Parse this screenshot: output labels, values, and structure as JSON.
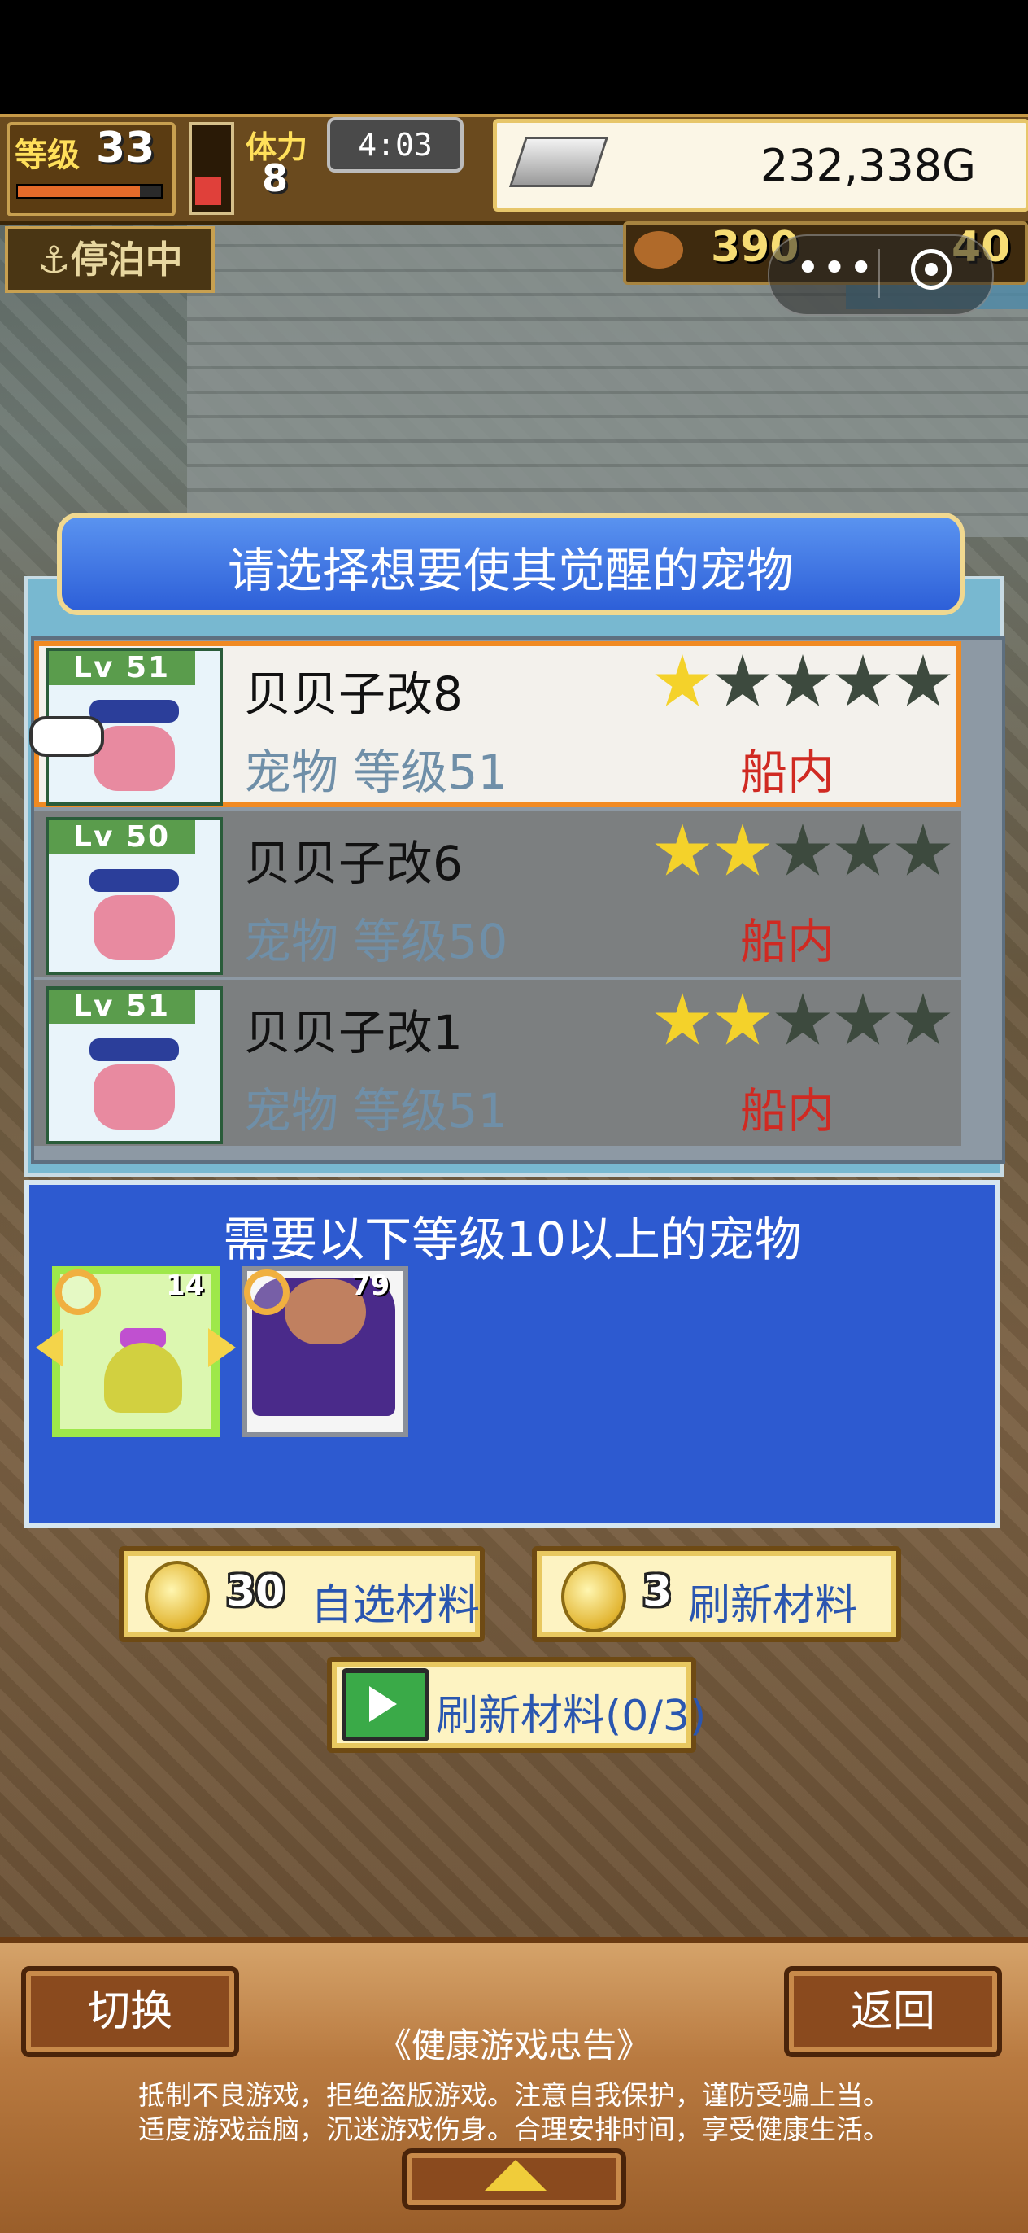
{
  "hud": {
    "level_label": "等级",
    "level_value": "33",
    "stamina_label": "体力",
    "stamina_value": "8",
    "clock": "4:03",
    "gold": "232,338G",
    "status": "⚓停泊中",
    "food_value": "390",
    "food_value2": "40"
  },
  "mini_program": {
    "more_icon": "more-dots-icon",
    "close_icon": "target-close-icon"
  },
  "dialog": {
    "title": "请选择想要使其觉醒的宠物",
    "pets": [
      {
        "level_badge": "Lv 51",
        "name": "贝贝子改8",
        "sub": "宠物 等级51",
        "location": "船内",
        "stars": 1,
        "max_stars": 5,
        "selected": true
      },
      {
        "level_badge": "Lv 50",
        "name": "贝贝子改6",
        "sub": "宠物 等级50",
        "location": "船内",
        "stars": 2,
        "max_stars": 5,
        "selected": false
      },
      {
        "level_badge": "Lv 51",
        "name": "贝贝子改1",
        "sub": "宠物 等级51",
        "location": "船内",
        "stars": 2,
        "max_stars": 5,
        "selected": false
      }
    ]
  },
  "requirement": {
    "title": "需要以下等级10以上的宠物",
    "cards": [
      {
        "level": "14"
      },
      {
        "level": "79"
      }
    ]
  },
  "buttons": {
    "select_material_count": "30",
    "select_material_label": "自选材料",
    "refresh_material_count": "3",
    "refresh_material_label": "刷新材料",
    "ad_refresh_label": "刷新材料(0/3)"
  },
  "bottom": {
    "switch_label": "切换",
    "back_label": "返回",
    "notice_title": "《健康游戏忠告》",
    "notice_line1": "抵制不良游戏，拒绝盗版游戏。注意自我保护，谨防受骗上当。",
    "notice_line2": "适度游戏益脑，沉迷游戏伤身。合理安排时间，享受健康生活。"
  },
  "colors": {
    "star_on": "#f4d22a",
    "star_off": "#3d4a3e",
    "location_red": "#d02a22",
    "selected_border": "#f08a22",
    "dialog_blue": "#2d5ad0"
  }
}
